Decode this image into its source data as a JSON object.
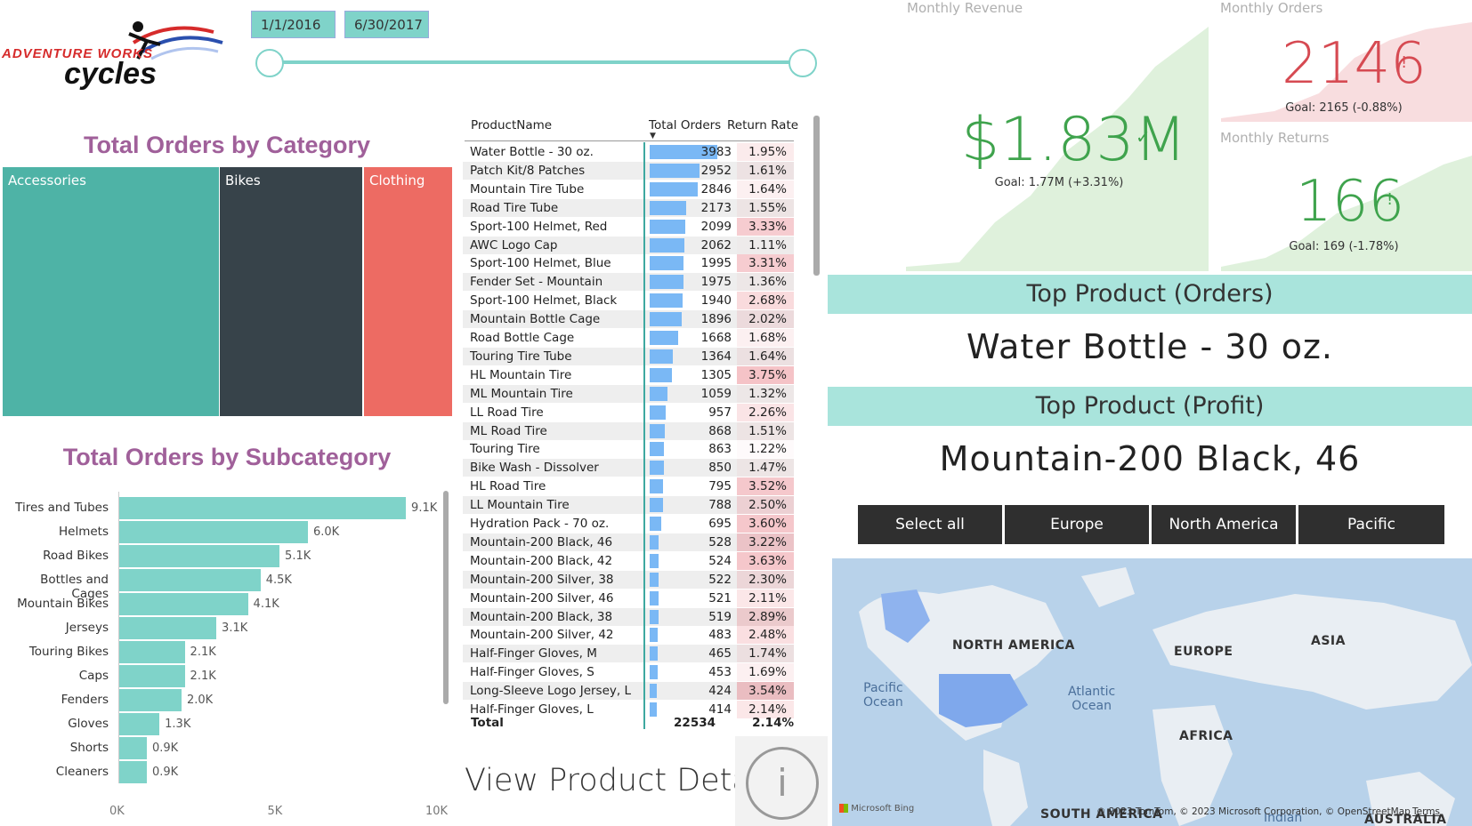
{
  "logo": {
    "line1": "ADVENTURE WORKS",
    "line2": "cycles"
  },
  "date_slicer": {
    "start": "1/1/2016",
    "end": "6/30/2017"
  },
  "category_chart": {
    "title": "Total Orders by Category",
    "cells": [
      {
        "label": "Accessories",
        "color": "#4eb3a6"
      },
      {
        "label": "Bikes",
        "color": "#37434a"
      },
      {
        "label": "Clothing",
        "color": "#ed6b63"
      }
    ]
  },
  "chart_data": {
    "type": "bar",
    "title": "Total Orders by Subcategory",
    "categories": [
      "Tires and Tubes",
      "Helmets",
      "Road Bikes",
      "Bottles and Cages",
      "Mountain Bikes",
      "Jerseys",
      "Touring Bikes",
      "Caps",
      "Fenders",
      "Gloves",
      "Shorts",
      "Cleaners"
    ],
    "values": [
      9100,
      6000,
      5100,
      4500,
      4100,
      3100,
      2100,
      2100,
      2000,
      1300,
      900,
      900
    ],
    "value_labels": [
      "9.1K",
      "6.0K",
      "5.1K",
      "4.5K",
      "4.1K",
      "3.1K",
      "2.1K",
      "2.1K",
      "2.0K",
      "1.3K",
      "0.9K",
      "0.9K"
    ],
    "xlim": [
      0,
      10000
    ],
    "x_ticks": [
      "0K",
      "5K",
      "10K"
    ],
    "orientation": "horizontal",
    "color": "#7fd3c9"
  },
  "product_table": {
    "columns": [
      "ProductName",
      "Total Orders",
      "Return Rate"
    ],
    "rows": [
      {
        "name": "Water Bottle - 30 oz.",
        "orders": 3983,
        "rate": "1.95%"
      },
      {
        "name": "Patch Kit/8 Patches",
        "orders": 2952,
        "rate": "1.61%"
      },
      {
        "name": "Mountain Tire Tube",
        "orders": 2846,
        "rate": "1.64%"
      },
      {
        "name": "Road Tire Tube",
        "orders": 2173,
        "rate": "1.55%"
      },
      {
        "name": "Sport-100 Helmet, Red",
        "orders": 2099,
        "rate": "3.33%"
      },
      {
        "name": "AWC Logo Cap",
        "orders": 2062,
        "rate": "1.11%"
      },
      {
        "name": "Sport-100 Helmet, Blue",
        "orders": 1995,
        "rate": "3.31%"
      },
      {
        "name": "Fender Set - Mountain",
        "orders": 1975,
        "rate": "1.36%"
      },
      {
        "name": "Sport-100 Helmet, Black",
        "orders": 1940,
        "rate": "2.68%"
      },
      {
        "name": "Mountain Bottle Cage",
        "orders": 1896,
        "rate": "2.02%"
      },
      {
        "name": "Road Bottle Cage",
        "orders": 1668,
        "rate": "1.68%"
      },
      {
        "name": "Touring Tire Tube",
        "orders": 1364,
        "rate": "1.64%"
      },
      {
        "name": "HL Mountain Tire",
        "orders": 1305,
        "rate": "3.75%"
      },
      {
        "name": "ML Mountain Tire",
        "orders": 1059,
        "rate": "1.32%"
      },
      {
        "name": "LL Road Tire",
        "orders": 957,
        "rate": "2.26%"
      },
      {
        "name": "ML Road Tire",
        "orders": 868,
        "rate": "1.51%"
      },
      {
        "name": "Touring Tire",
        "orders": 863,
        "rate": "1.22%"
      },
      {
        "name": "Bike Wash - Dissolver",
        "orders": 850,
        "rate": "1.47%"
      },
      {
        "name": "HL Road Tire",
        "orders": 795,
        "rate": "3.52%"
      },
      {
        "name": "LL Mountain Tire",
        "orders": 788,
        "rate": "2.50%"
      },
      {
        "name": "Hydration Pack - 70 oz.",
        "orders": 695,
        "rate": "3.60%"
      },
      {
        "name": "Mountain-200 Black, 46",
        "orders": 528,
        "rate": "3.22%"
      },
      {
        "name": "Mountain-200 Black, 42",
        "orders": 524,
        "rate": "3.63%"
      },
      {
        "name": "Mountain-200 Silver, 38",
        "orders": 522,
        "rate": "2.30%"
      },
      {
        "name": "Mountain-200 Silver, 46",
        "orders": 521,
        "rate": "2.11%"
      },
      {
        "name": "Mountain-200 Black, 38",
        "orders": 519,
        "rate": "2.89%"
      },
      {
        "name": "Mountain-200 Silver, 42",
        "orders": 483,
        "rate": "2.48%"
      },
      {
        "name": "Half-Finger Gloves, M",
        "orders": 465,
        "rate": "1.74%"
      },
      {
        "name": "Half-Finger Gloves, S",
        "orders": 453,
        "rate": "1.69%"
      },
      {
        "name": "Long-Sleeve Logo Jersey, L",
        "orders": 424,
        "rate": "3.54%"
      },
      {
        "name": "Half-Finger Gloves, L",
        "orders": 414,
        "rate": "2.14%"
      }
    ],
    "total": {
      "label": "Total",
      "orders": "22534",
      "rate": "2.14%"
    },
    "max_orders": 3983
  },
  "view_detail": {
    "label": "View Product Detail",
    "icon_glyph": "i"
  },
  "kpi": {
    "revenue": {
      "title": "Monthly Revenue",
      "value": "$1.83M",
      "mark": "✓",
      "goal": "Goal: 1.77M (+3.31%)",
      "color": "#3fa34d"
    },
    "orders": {
      "title": "Monthly Orders",
      "value": "2146",
      "mark": "!",
      "goal": "Goal: 2165 (-0.88%)",
      "color": "#d64a52"
    },
    "returns": {
      "title": "Monthly Returns",
      "value": "166",
      "mark": "!",
      "goal": "Goal: 169 (-1.78%)",
      "color": "#3fa34d"
    }
  },
  "top_orders": {
    "label": "Top Product (Orders)",
    "value": "Water Bottle - 30 oz."
  },
  "top_profit": {
    "label": "Top Product (Profit)",
    "value": "Mountain-200 Black, 46"
  },
  "regions": [
    "Select all",
    "Europe",
    "North America",
    "Pacific"
  ],
  "map": {
    "labels": [
      "NORTH AMERICA",
      "EUROPE",
      "ASIA",
      "AFRICA",
      "SOUTH AMERICA",
      "AUSTRALIA"
    ],
    "oceans": [
      "Pacific\nOcean",
      "Atlantic\nOcean",
      "Indian"
    ],
    "brand": "Microsoft Bing",
    "attribution": "© 2023 TomTom, © 2023 Microsoft Corporation, © OpenStreetMap",
    "terms": "Terms"
  }
}
